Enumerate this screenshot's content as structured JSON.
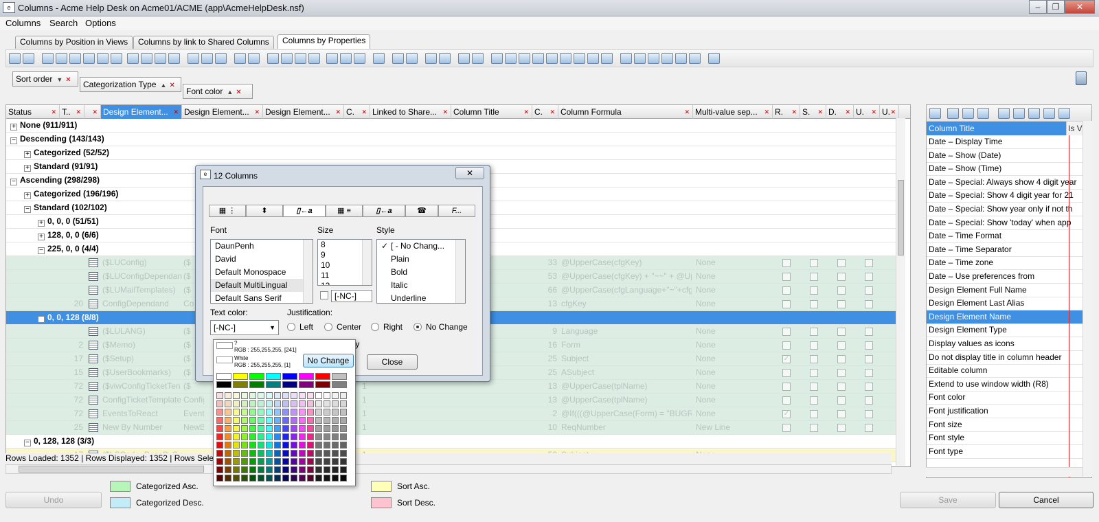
{
  "window": {
    "title": "Columns - Acme Help Desk on Acme01/ACME (app\\AcmeHelpDesk.nsf)",
    "icon": "app-icon",
    "controls": [
      "minimize",
      "restore",
      "close"
    ]
  },
  "menu": [
    "Columns",
    "Search",
    "Options"
  ],
  "tabs": [
    "Columns by Position in Views",
    "Columns by link to Shared Columns",
    "Columns by Properties"
  ],
  "groupby": [
    "Sort order",
    "Categorization Type",
    "Font color"
  ],
  "grid": {
    "headers": [
      "Status",
      "T..",
      "",
      "Design Element...",
      "Design Element...",
      "Design Element...",
      "C.",
      "Linked to Share...",
      "Column Title",
      "C.",
      "Column Formula",
      "Multi-value sep...",
      "R.",
      "S.",
      "D.",
      "U.",
      "U."
    ],
    "groups": [
      {
        "label": "None (911/911)",
        "level": 0,
        "exp": "+"
      },
      {
        "label": "Descending (143/143)",
        "level": 0,
        "exp": "−"
      },
      {
        "label": "Categorized (52/52)",
        "level": 1,
        "exp": "+"
      },
      {
        "label": "Standard (91/91)",
        "level": 1,
        "exp": "+"
      },
      {
        "label": "Ascending (298/298)",
        "level": 0,
        "exp": "−"
      },
      {
        "label": "Categorized (196/196)",
        "level": 1,
        "exp": "+"
      },
      {
        "label": "Standard (102/102)",
        "level": 1,
        "exp": "−"
      },
      {
        "label": "0, 0, 0 (51/51)",
        "level": 2,
        "exp": "+"
      },
      {
        "label": "128, 0, 0 (6/6)",
        "level": 2,
        "exp": "+"
      },
      {
        "label": "225, 0, 0 (4/4)",
        "level": 2,
        "exp": "−"
      }
    ],
    "rows_a": [
      {
        "n": "",
        "name": "($LUConfig)",
        "alias": "($",
        "c2": "33",
        "formula": "@UpperCase(cfgKey)",
        "sep": "None",
        "r": false,
        "s": false
      },
      {
        "n": "",
        "name": "($LUConfigDependan",
        "alias": "($",
        "c2": "53",
        "formula": "@UpperCase(cfgKey) + \"~~\" + @Upp",
        "sep": "None",
        "r": false,
        "s": false
      },
      {
        "n": "",
        "name": "($LUMailTemplates)",
        "alias": "($",
        "c2": "66",
        "formula": "@UpperCase(cfgLanguage+\"~\"+cfgk",
        "sep": "None",
        "r": false,
        "s": false
      },
      {
        "n": "20",
        "name": "ConfigDependand",
        "alias": "Co",
        "c2": "13",
        "formula": "cfgKey",
        "sep": "None",
        "r": false,
        "s": false
      }
    ],
    "selgroup": "0, 0, 128 (8/8)",
    "rows_b": [
      {
        "n": "",
        "name": "($LULANG)",
        "alias": "($",
        "c1": "",
        "c2": "9",
        "formula": "Language",
        "sep": "None",
        "r": false,
        "s": false
      },
      {
        "n": "2",
        "name": "($Memo)",
        "alias": "($",
        "c1": "",
        "c2": "16",
        "formula": "Form",
        "sep": "None",
        "r": false,
        "s": false
      },
      {
        "n": "17",
        "name": "($Setup)",
        "alias": "($",
        "c1": "",
        "c2": "25",
        "formula": "Subject",
        "sep": "None",
        "r": true,
        "s": false
      },
      {
        "n": "15",
        "name": "($UserBookmarks)",
        "alias": "($",
        "c1": "",
        "c2": "25",
        "formula": "ASubject",
        "sep": "None",
        "r": false,
        "s": false
      },
      {
        "n": "72",
        "name": "($viwConfigTicketTen",
        "alias": "($",
        "c1": "1",
        "c2": "13",
        "formula": "@UpperCase(tplName)",
        "sep": "None",
        "r": false,
        "s": false
      },
      {
        "n": "72",
        "name": "ConfigTicketTemplate",
        "alias": "Config",
        "c1": "1",
        "c2": "13",
        "formula": "@UpperCase(tplName)",
        "sep": "None",
        "r": false,
        "s": false
      },
      {
        "n": "72",
        "name": "EventsToReact",
        "alias": "EventsT",
        "c1": "1",
        "c2": "2",
        "formula": "@If(((@UpperCase(Form) = \"BUGREP",
        "sep": "None",
        "r": true,
        "s": false
      },
      {
        "n": "25",
        "name": "New By Number",
        "alias": "NewByN",
        "c1": "1",
        "c2": "10",
        "formula": "ReqNumber",
        "sep": "New Line",
        "r": false,
        "s": false
      }
    ],
    "lastgroup": "0, 128, 128 (3/3)",
    "partial": {
      "n": "17",
      "name": "($LSCode_DescBySub",
      "c1": "1",
      "c2": "50",
      "formula": "Subject",
      "sep": "None"
    }
  },
  "status": "Rows Loaded: 1352  |  Rows Displayed: 1352  |  Rows Selec",
  "right_panel": {
    "header": "Column Title",
    "header2": "Is V",
    "items": [
      "Date – Display Time",
      "Date – Show (Date)",
      "Date – Show (Time)",
      "Date – Special: Always show 4 digit year",
      "Date – Special: Show 4 digit year for 21",
      "Date – Special: Show year only if not th",
      "Date – Special: Show 'today' when app",
      "Date – Time Format",
      "Date – Time Separator",
      "Date – Time zone",
      "Date – Use preferences from",
      "Design Element Full Name",
      "Design Element Last Alias",
      "Design Element Name",
      "Design Element Type",
      "Display values as icons",
      "Do not display title in column header",
      "Editable column",
      "Extend to use window width (R8)",
      "Font color",
      "Font justification",
      "Font size",
      "Font style",
      "Font type"
    ],
    "selected_index": 13
  },
  "dialog": {
    "title": "12 Columns",
    "close": "✕",
    "font_label": "Font",
    "fonts": [
      "DaunPenh",
      "David",
      "Default Monospace",
      "Default MultiLingual",
      "Default Sans Serif"
    ],
    "font_selected": 3,
    "size_label": "Size",
    "sizes": [
      "8",
      "9",
      "10",
      "11",
      "12"
    ],
    "nc": "[-NC-]",
    "style_label": "Style",
    "styles": [
      "[ - No Chang...",
      "Plain",
      "Bold",
      "Italic",
      "Underline"
    ],
    "textcolor_label": "Text color:",
    "textcolor_value": "[-NC-]",
    "just_label": "Justification:",
    "just_options": [
      "Left",
      "Center",
      "Right",
      "No Change"
    ],
    "just_selected": 3,
    "ply": "ply",
    "close_btn": "Close",
    "tab6_label": "F..."
  },
  "colorpop": {
    "c1_name": "?",
    "c1_rgb": "RGB : 255,255,255, [241]",
    "c2_name": "White",
    "c2_rgb": "RGB : 255,255,255, [1]",
    "nochange": "No Change"
  },
  "bottom": {
    "undo": "Undo",
    "save": "Save",
    "cancel": "Cancel",
    "legend": [
      {
        "label": "Categorized Asc.",
        "color": "#b8f5b8"
      },
      {
        "label": "Categorized Desc.",
        "color": "#c2ecf7"
      },
      {
        "label": "Sort Asc.",
        "color": "#ffffb8"
      },
      {
        "label": "Sort Desc.",
        "color": "#ffc2cf"
      }
    ]
  },
  "colors": {
    "selection": "#3f8fe3",
    "row_tint": "#dceee4",
    "filter_red": "#bb0000"
  }
}
